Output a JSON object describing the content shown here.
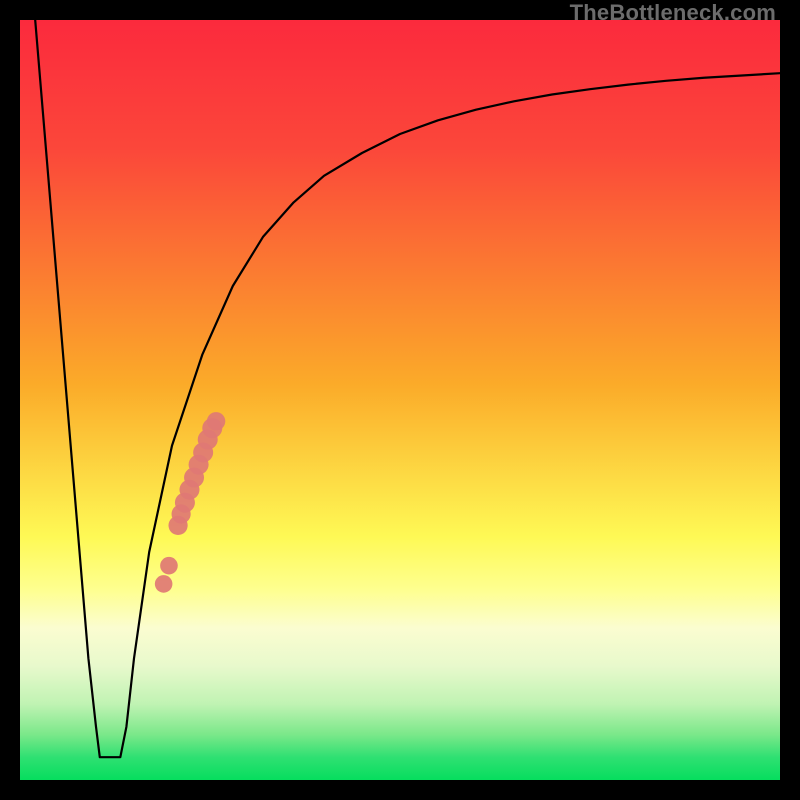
{
  "watermark": "TheBottleneck.com",
  "colors": {
    "frame": "#000000",
    "curve": "#000000",
    "dot": "#e07874",
    "gradient_red": "#fb2a3d",
    "gradient_orange": "#fbab29",
    "gradient_yellow": "#fef955",
    "gradient_pale": "#f7fbc5",
    "gradient_green_mid": "#7be88a",
    "gradient_green": "#06de5e"
  },
  "chart_data": {
    "type": "line",
    "title": "",
    "xlabel": "",
    "ylabel": "",
    "xlim": [
      0,
      100
    ],
    "ylim": [
      0,
      100
    ],
    "curve": {
      "x": [
        2,
        3,
        4,
        5,
        6,
        7,
        8,
        9,
        10,
        11,
        12,
        13,
        14,
        15,
        17,
        20,
        24,
        28,
        32,
        36,
        40,
        45,
        50,
        55,
        60,
        65,
        70,
        75,
        80,
        85,
        90,
        95,
        100
      ],
      "y": [
        100,
        88,
        76,
        64,
        52,
        40,
        28,
        16,
        7,
        3,
        3,
        3,
        7,
        16,
        30,
        44,
        56,
        65,
        71.5,
        76,
        79.5,
        82.5,
        85,
        86.8,
        88.2,
        89.3,
        90.2,
        90.9,
        91.5,
        92,
        92.4,
        92.7,
        93
      ]
    },
    "valley_flat": {
      "x_start": 10.5,
      "x_end": 13.2,
      "y": 3
    },
    "dots": [
      {
        "x": 18.9,
        "y": 25.8,
        "r": 1.2
      },
      {
        "x": 19.6,
        "y": 28.2,
        "r": 1.2
      },
      {
        "x": 20.8,
        "y": 33.5,
        "r": 1.4
      },
      {
        "x": 21.2,
        "y": 35.0,
        "r": 1.4
      },
      {
        "x": 21.7,
        "y": 36.5,
        "r": 1.5
      },
      {
        "x": 22.3,
        "y": 38.2,
        "r": 1.5
      },
      {
        "x": 22.9,
        "y": 39.8,
        "r": 1.5
      },
      {
        "x": 23.5,
        "y": 41.5,
        "r": 1.5
      },
      {
        "x": 24.1,
        "y": 43.1,
        "r": 1.5
      },
      {
        "x": 24.7,
        "y": 44.8,
        "r": 1.5
      },
      {
        "x": 25.3,
        "y": 46.3,
        "r": 1.5
      },
      {
        "x": 25.8,
        "y": 47.2,
        "r": 1.3
      }
    ],
    "gradient_stops": [
      {
        "offset": 0,
        "color": "#fb2a3d"
      },
      {
        "offset": 17,
        "color": "#fb473a"
      },
      {
        "offset": 48,
        "color": "#fbab29"
      },
      {
        "offset": 68,
        "color": "#fef955"
      },
      {
        "offset": 75,
        "color": "#feff90"
      },
      {
        "offset": 80,
        "color": "#fbfdd0"
      },
      {
        "offset": 85,
        "color": "#e8f9cc"
      },
      {
        "offset": 90,
        "color": "#c0f3b3"
      },
      {
        "offset": 94,
        "color": "#7be88a"
      },
      {
        "offset": 97,
        "color": "#2fe072"
      },
      {
        "offset": 100,
        "color": "#06de5e"
      }
    ]
  }
}
